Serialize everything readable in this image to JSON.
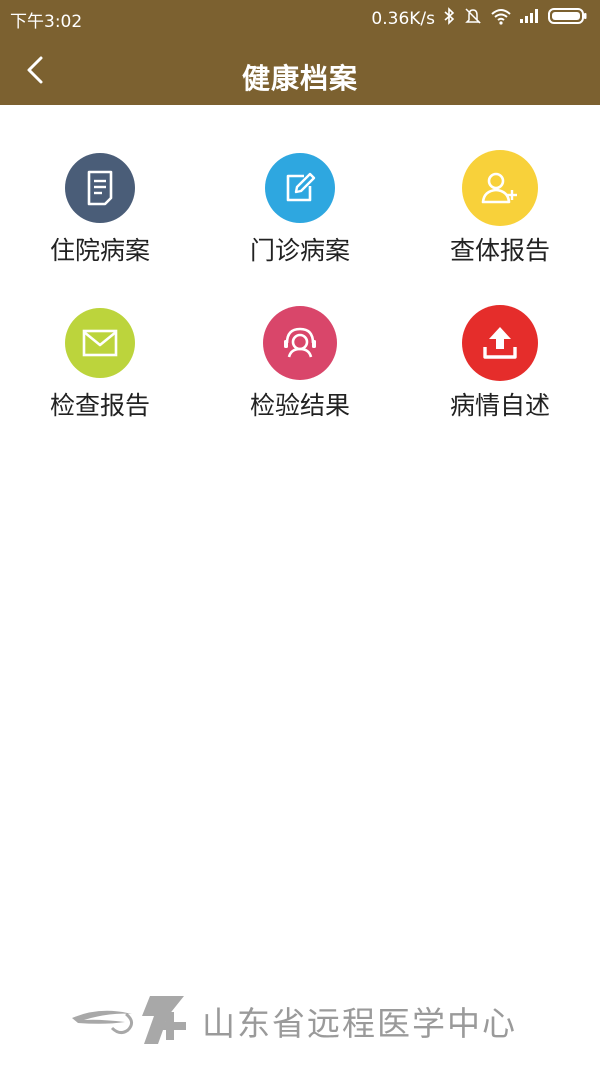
{
  "status_bar": {
    "time": "下午3:02",
    "network_speed": "0.36K/s",
    "icons": [
      "bluetooth-icon",
      "mute-icon",
      "wifi-icon",
      "signal-icon",
      "battery-icon"
    ]
  },
  "nav": {
    "title": "健康档案",
    "back_icon": "chevron-left-icon",
    "bg_color": "#7c6130"
  },
  "menu": [
    {
      "label": "住院病案",
      "icon": "document-icon",
      "color": "#4a5d78"
    },
    {
      "label": "门诊病案",
      "icon": "edit-icon",
      "color": "#2ea7e0"
    },
    {
      "label": "查体报告",
      "icon": "user-add-icon",
      "color": "#f8d13a"
    },
    {
      "label": "检查报告",
      "icon": "mail-icon",
      "color": "#bcd43c"
    },
    {
      "label": "检验结果",
      "icon": "headset-user-icon",
      "color": "#d9466a"
    },
    {
      "label": "病情自述",
      "icon": "upload-icon",
      "color": "#e52d2b"
    }
  ],
  "footer": {
    "org_name": "山东省远程医学中心"
  }
}
